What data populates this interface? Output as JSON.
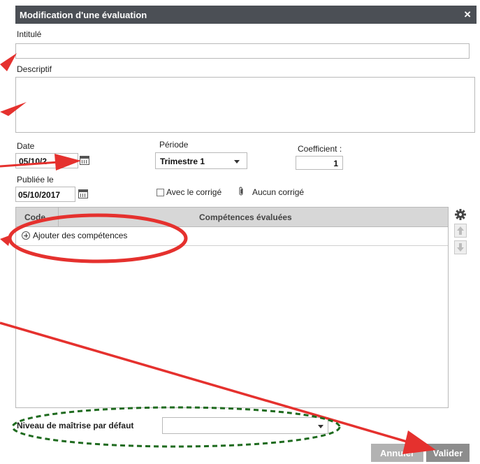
{
  "dialog": {
    "title": "Modification d'une évaluation",
    "close": "×"
  },
  "form": {
    "intitule_label": "Intitulé",
    "intitule_value": "",
    "descriptif_label": "Descriptif",
    "descriptif_value": "",
    "date_label": "Date",
    "date_value": "05/10/2",
    "periode_label": "Période",
    "periode_value": "Trimestre 1",
    "coefficient_label": "Coefficient :",
    "coefficient_value": "1",
    "publiee_label": "Publiée le",
    "publiee_value": "05/10/2017",
    "corrige_label": "Avec le corrigé",
    "aucun_corrige": "Aucun corrigé"
  },
  "grid": {
    "columns": [
      "Code",
      "Compétences évaluées"
    ],
    "add_row": "Ajouter des compétences"
  },
  "niveau": {
    "label": "Niveau de maîtrise par défaut",
    "value": ""
  },
  "buttons": {
    "annuler": "Annuler",
    "valider": "Valider"
  },
  "colors": {
    "titlebar": "#4b4f55",
    "annotation_red": "#e5312e",
    "annotation_green": "#1f6b1f"
  },
  "icons": {
    "calendar": "calendar-icon",
    "gear": "gear-icon",
    "paperclip": "paperclip-icon",
    "plus": "plus-circle-icon",
    "up": "arrow-up-icon",
    "down": "arrow-down-icon"
  }
}
